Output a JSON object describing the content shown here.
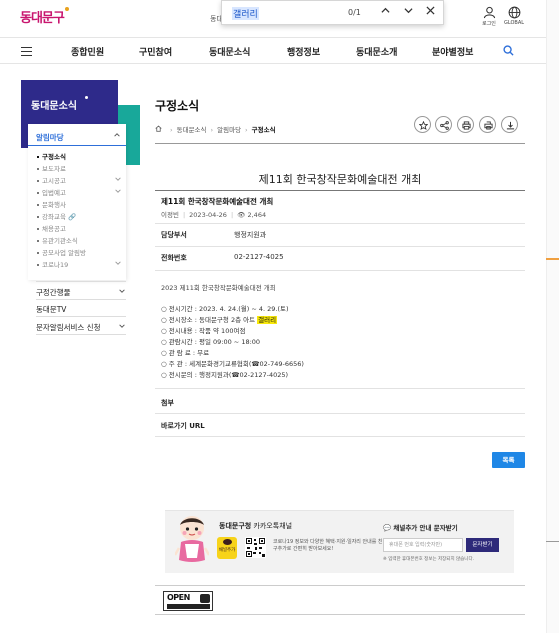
{
  "header": {
    "logo_text": "동대문구",
    "top_menu_stub": "동대",
    "find": {
      "query": "갤러리",
      "count": "0/1"
    },
    "login_label": "로그인",
    "global_label": "GLOBAL"
  },
  "gnb": {
    "items": [
      "종합민원",
      "구민참여",
      "동대문소식",
      "행정정보",
      "동대문소개",
      "분야별정보"
    ]
  },
  "sidebar": {
    "title": "동대문소식",
    "category": "알림마당",
    "subitems": [
      "구정소식",
      "보도자료",
      "고시공고",
      "입법예고",
      "문화행사",
      "강좌교육",
      "채용공고",
      "유관기관소식",
      "공모사업 알림방",
      "코로나19"
    ],
    "menus": [
      "구정간행물",
      "동대문TV",
      "문자알림서비스 신청"
    ]
  },
  "content": {
    "page_title": "구정소식",
    "breadcrumb": [
      "동대문소식",
      "알림마당",
      "구정소식"
    ],
    "post_title": "제11회 한국창작문화예술대전 개최",
    "subject": "제11회 한국창작문화예술대전 개최",
    "author": "이정빈",
    "date": "2023-04-26",
    "views": "2,464",
    "dept_label": "담당부서",
    "dept_value": "행정지원과",
    "phone_label": "전화번호",
    "phone_value": "02-2127-4025",
    "body_lead": "2023 제11회 한국창작문화예술대전 개최",
    "body_lines": [
      "○ 전시기간 : 2023. 4. 24.(월) ~ 4. 29.(토)",
      "○ 전시장소 : 동대문구청 2층 아트",
      "○ 전시내용 : 작품 약 100여점",
      "○ 관람시간 : 평일 09:00 ~ 18:00",
      "○ 관 람 료 : 무료",
      "○ 주    관 : 세계문화경기교류협회(☎02-749-6656)",
      "○ 전시문의 : 행정지원과(☎02-2127-4025)"
    ],
    "highlight": "갤러리",
    "attach_label": "첨부",
    "shortcut_label": "바로가기 URL",
    "list_button": "목록"
  },
  "kakao": {
    "title_bold": "동대문구청",
    "title_rest": " 카카오톡채널",
    "channel_label": "채널추가",
    "desc": "코로나19 정보와 다양한 혜택·지원·일자리 안내를 친구추가로 간편히 받아보세요!",
    "sms_title": "채널추가 안내 문자받기",
    "sms_placeholder": "휴대폰 번호 입력(숫자만)",
    "sms_button": "문자받기",
    "sms_note": "※ 입력한 휴대폰번호 정보는 저장되지 않습니다."
  },
  "open_badge": {
    "word": "OPEN"
  }
}
